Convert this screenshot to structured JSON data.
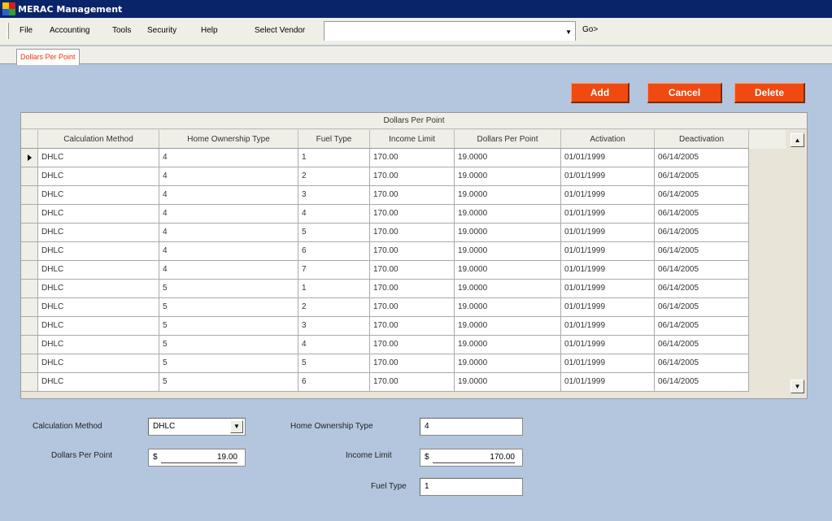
{
  "window": {
    "title": "MERAC Management"
  },
  "menu": {
    "items": [
      "File",
      "Accounting",
      "Tools",
      "Security",
      "Help"
    ],
    "vendor_label": "Select Vendor",
    "vendor_value": "",
    "go_label": "Go>"
  },
  "tabs": [
    "Dollars Per Point"
  ],
  "actions": {
    "add": "Add",
    "cancel": "Cancel",
    "delete": "Delete"
  },
  "grid": {
    "caption": "Dollars Per Point",
    "columns": [
      "Calculation Method",
      "Home Ownership Type",
      "Fuel Type",
      "Income Limit",
      "Dollars Per Point",
      "Activation",
      "Deactivation"
    ],
    "rows": [
      [
        "DHLC",
        "4",
        "1",
        "170.00",
        "19.0000",
        "01/01/1999",
        "06/14/2005"
      ],
      [
        "DHLC",
        "4",
        "2",
        "170.00",
        "19.0000",
        "01/01/1999",
        "06/14/2005"
      ],
      [
        "DHLC",
        "4",
        "3",
        "170.00",
        "19.0000",
        "01/01/1999",
        "06/14/2005"
      ],
      [
        "DHLC",
        "4",
        "4",
        "170.00",
        "19.0000",
        "01/01/1999",
        "06/14/2005"
      ],
      [
        "DHLC",
        "4",
        "5",
        "170.00",
        "19.0000",
        "01/01/1999",
        "06/14/2005"
      ],
      [
        "DHLC",
        "4",
        "6",
        "170.00",
        "19.0000",
        "01/01/1999",
        "06/14/2005"
      ],
      [
        "DHLC",
        "4",
        "7",
        "170.00",
        "19.0000",
        "01/01/1999",
        "06/14/2005"
      ],
      [
        "DHLC",
        "5",
        "1",
        "170.00",
        "19.0000",
        "01/01/1999",
        "06/14/2005"
      ],
      [
        "DHLC",
        "5",
        "2",
        "170.00",
        "19.0000",
        "01/01/1999",
        "06/14/2005"
      ],
      [
        "DHLC",
        "5",
        "3",
        "170.00",
        "19.0000",
        "01/01/1999",
        "06/14/2005"
      ],
      [
        "DHLC",
        "5",
        "4",
        "170.00",
        "19.0000",
        "01/01/1999",
        "06/14/2005"
      ],
      [
        "DHLC",
        "5",
        "5",
        "170.00",
        "19.0000",
        "01/01/1999",
        "06/14/2005"
      ],
      [
        "DHLC",
        "5",
        "6",
        "170.00",
        "19.0000",
        "01/01/1999",
        "06/14/2005"
      ]
    ],
    "selected_row": 0
  },
  "form": {
    "calc_method_label": "Calculation Method",
    "calc_method_value": "DHLC",
    "home_type_label": "Home Ownership Type",
    "home_type_value": "4",
    "dpp_label": "Dollars Per Point",
    "dpp_currency": "$",
    "dpp_value": "19.00",
    "income_label": "Income Limit",
    "income_currency": "$",
    "income_value": "170.00",
    "fuel_label": "Fuel Type",
    "fuel_value": "1"
  },
  "colors": {
    "accent": "#f04a10",
    "title_bar": "#0a246a",
    "background": "#b3c6de",
    "tab_text": "#ff2a00"
  }
}
